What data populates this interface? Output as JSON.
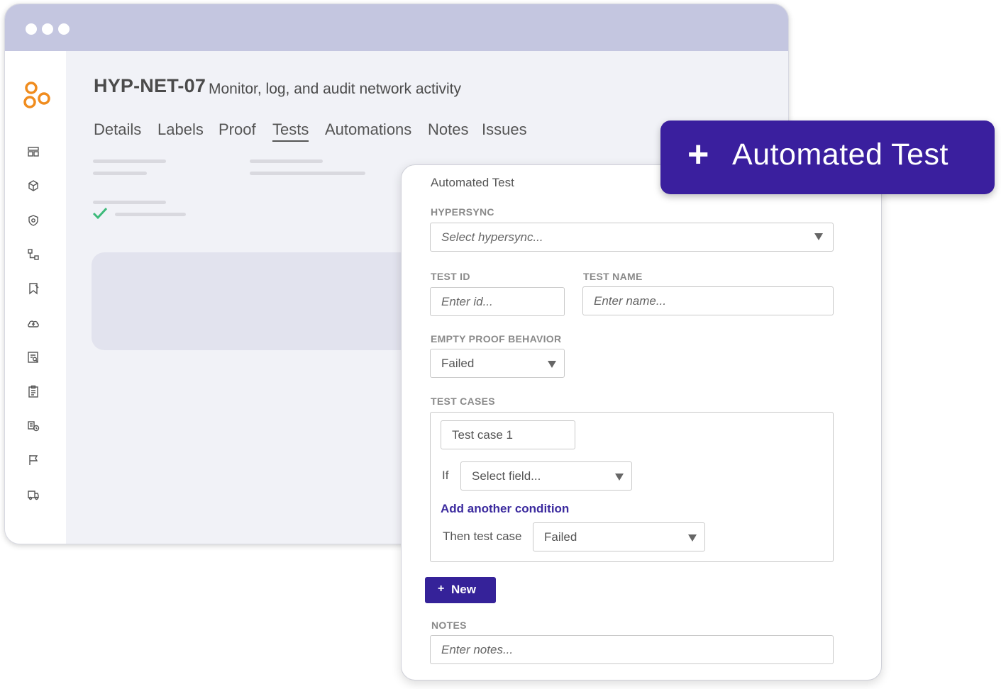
{
  "header": {
    "code": "HYP-NET-07",
    "description": "Monitor, log, and audit network activity"
  },
  "tabs": [
    {
      "label": "Details"
    },
    {
      "label": "Labels"
    },
    {
      "label": "Proof"
    },
    {
      "label": "Tests",
      "active": true
    },
    {
      "label": "Automations"
    },
    {
      "label": "Notes"
    },
    {
      "label": "Issues"
    }
  ],
  "sidebar": {
    "icons": [
      "dashboard-icon",
      "cube-icon",
      "shield-icon",
      "workflow-icon",
      "bookmark-icon",
      "cloud-upload-icon",
      "report-search-icon",
      "clipboard-list-icon",
      "vendor-icon",
      "flag-icon",
      "truck-icon"
    ]
  },
  "form": {
    "title": "Automated Test",
    "hypersync_label": "HYPERSYNC",
    "hypersync_placeholder": "Select hypersync...",
    "test_id_label": "TEST ID",
    "test_id_placeholder": "Enter id...",
    "test_name_label": "TEST NAME",
    "test_name_placeholder": "Enter name...",
    "empty_proof_label": "EMPTY PROOF BEHAVIOR",
    "empty_proof_value": "Failed",
    "test_cases_label": "TEST CASES",
    "test_case_name": "Test case 1",
    "if_label": "If",
    "field_select_placeholder": "Select field...",
    "add_condition": "Add another condition",
    "then_label": "Then test case",
    "then_value": "Failed",
    "new_button_icon": "+",
    "new_button": "New",
    "notes_label": "NOTES",
    "notes_placeholder": "Enter notes..."
  },
  "callout": {
    "icon": "+",
    "label": "Automated Test"
  },
  "colors": {
    "accent": "#352299",
    "callout": "#3a1f9e",
    "logo": "#f08c1e",
    "check": "#3dba7a",
    "titlebar": "#c4c6e0"
  }
}
